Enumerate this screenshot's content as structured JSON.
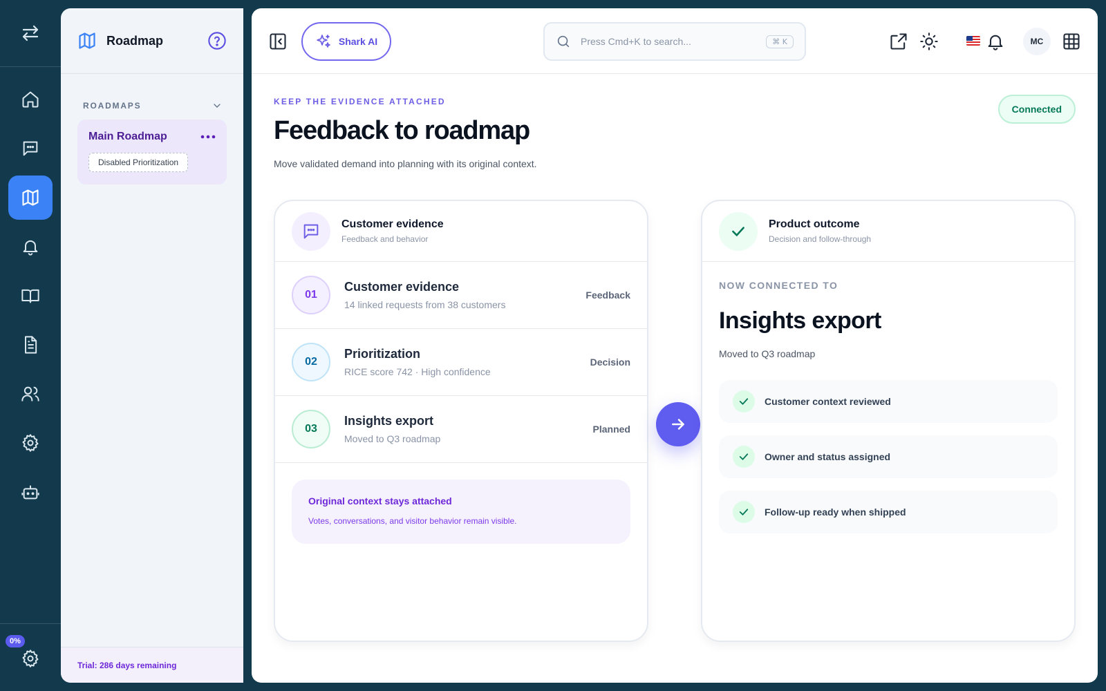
{
  "rail": {
    "progress_badge": "0%",
    "items": [
      {
        "icon": "home-icon"
      },
      {
        "icon": "chat-icon"
      },
      {
        "icon": "map-icon",
        "active": true
      },
      {
        "icon": "bell-icon"
      },
      {
        "icon": "book-icon"
      },
      {
        "icon": "document-icon"
      },
      {
        "icon": "users-icon"
      },
      {
        "icon": "gear-icon"
      },
      {
        "icon": "robot-icon"
      }
    ]
  },
  "sidebar": {
    "title": "Roadmap",
    "section_label": "ROADMAPS",
    "roadmap": {
      "name": "Main Roadmap",
      "status_pill": "Disabled Prioritization"
    },
    "trial_text": "Trial: 286 days remaining"
  },
  "topbar": {
    "ai_button_label": "Shark AI",
    "search": {
      "placeholder": "Press Cmd+K to search...",
      "shortcut": "⌘ K"
    },
    "avatar_initials": "MC",
    "flag": "US"
  },
  "main": {
    "eyebrow": "KEEP THE EVIDENCE ATTACHED",
    "title": "Feedback to roadmap",
    "subtitle": "Move validated demand into planning with its original context.",
    "status_badge": "Connected",
    "evidence_card": {
      "title": "Customer evidence",
      "subtitle": "Feedback and behavior",
      "steps": [
        {
          "number": "01",
          "title": "Customer evidence",
          "subtitle": "14 linked requests from 38 customers",
          "tag": "Feedback",
          "accent": "#7c3aed"
        },
        {
          "number": "02",
          "title": "Prioritization",
          "subtitle": "RICE score 742 · High confidence",
          "tag": "Decision",
          "accent": "#0369a1"
        },
        {
          "number": "03",
          "title": "Insights export",
          "subtitle": "Moved to Q3 roadmap",
          "tag": "Planned",
          "accent": "#047857"
        }
      ],
      "context_title": "Original context stays attached",
      "context_subtitle": "Votes, conversations, and visitor behavior remain visible."
    },
    "outcome_card": {
      "title": "Product outcome",
      "subtitle": "Decision and follow-through",
      "eyebrow": "NOW CONNECTED TO",
      "headline": "Insights export",
      "headline_sub": "Moved to Q3 roadmap",
      "checks": [
        "Customer context reviewed",
        "Owner and status assigned",
        "Follow-up ready when shipped"
      ]
    }
  },
  "colors": {
    "rail_bg": "#123a4c",
    "active_rail": "#3b82f6",
    "accent_purple": "#5f5cf0",
    "success_green": "#047857"
  }
}
